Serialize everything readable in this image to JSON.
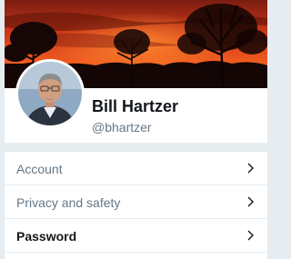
{
  "profile": {
    "name": "Bill Hartzer",
    "handle": "@bhartzer",
    "banner_icon": "sunset-trees-image",
    "avatar_icon": "profile-photo"
  },
  "settings_menu": {
    "items": [
      {
        "label": "Account",
        "active": false,
        "icon": "chevron-right-icon"
      },
      {
        "label": "Privacy and safety",
        "active": false,
        "icon": "chevron-right-icon"
      },
      {
        "label": "Password",
        "active": true,
        "icon": "chevron-right-icon"
      }
    ]
  },
  "colors": {
    "background": "#e6ecf0",
    "primary_text": "#14171a",
    "secondary_text": "#657786"
  }
}
